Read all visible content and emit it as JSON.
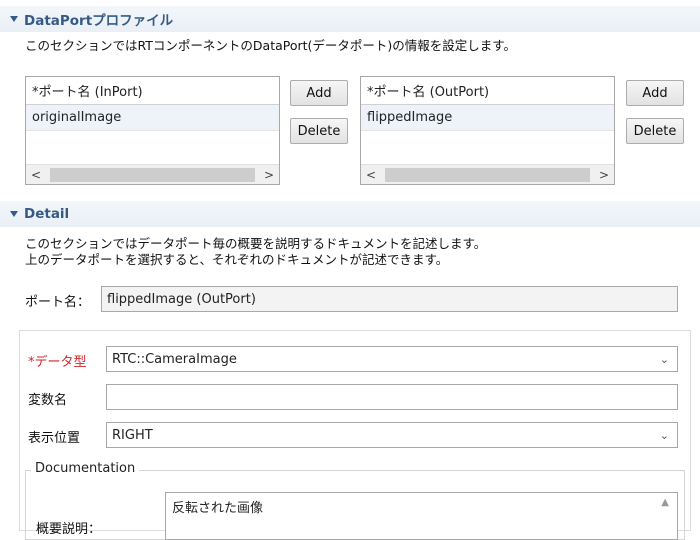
{
  "dataport_section": {
    "title": "DataPortプロファイル",
    "description": "このセクションではRTコンポーネントのDataPort(データポート)の情報を設定します。",
    "inport": {
      "header": "*ポート名 (InPort)",
      "rows": [
        "originalImage"
      ],
      "add_label": "Add",
      "delete_label": "Delete"
    },
    "outport": {
      "header": "*ポート名 (OutPort)",
      "rows": [
        "flippedImage"
      ],
      "add_label": "Add",
      "delete_label": "Delete"
    }
  },
  "detail_section": {
    "title": "Detail",
    "description_line1": "このセクションではデータポート毎の概要を説明するドキュメントを記述します。",
    "description_line2": "上のデータポートを選択すると、それぞれのドキュメントが記述できます。",
    "port_name_label": "ポート名：",
    "port_name_value": "flippedImage (OutPort)",
    "data_type_label": "*データ型",
    "data_type_value": "RTC::CameraImage",
    "variable_name_label": "変数名",
    "variable_name_value": "",
    "display_position_label": "表示位置",
    "display_position_value": "RIGHT",
    "documentation_legend": "Documentation",
    "summary_label": "概要説明：",
    "summary_value": "反転された画像"
  },
  "colors": {
    "section_title": "#355a85",
    "required_label": "#d0262b"
  }
}
